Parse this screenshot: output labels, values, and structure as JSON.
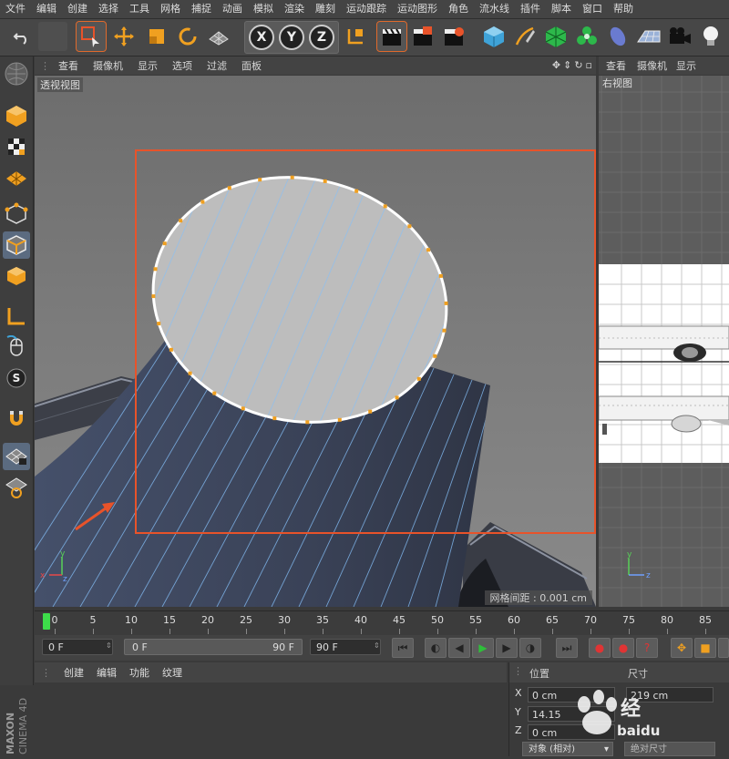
{
  "menu": [
    "文件",
    "编辑",
    "创建",
    "选择",
    "工具",
    "网格",
    "捕捉",
    "动画",
    "模拟",
    "渲染",
    "雕刻",
    "运动跟踪",
    "运动图形",
    "角色",
    "流水线",
    "插件",
    "脚本",
    "窗口",
    "帮助"
  ],
  "toolbar": {
    "axis_x": "X",
    "axis_y": "Y",
    "axis_z": "Z"
  },
  "viewport": {
    "menu": [
      "查看",
      "摄像机",
      "显示",
      "选项",
      "过滤",
      "面板"
    ],
    "name": "透视视图",
    "grid_spacing": "网格间距 : 0.001 cm"
  },
  "right_viewport": {
    "menu": [
      "查看",
      "摄像机",
      "显示"
    ],
    "name": "右视图"
  },
  "timeline": {
    "ticks": [
      "0",
      "5",
      "10",
      "15",
      "20",
      "25",
      "30",
      "35",
      "40",
      "45",
      "50",
      "55",
      "60",
      "65",
      "70",
      "75",
      "80",
      "85"
    ],
    "current_frame_marker": 0
  },
  "transport": {
    "start_frame": "0 F",
    "preview_start": "0 F",
    "preview_end": "90 F",
    "end_frame": "90 F"
  },
  "material_panel": {
    "menu": [
      "创建",
      "编辑",
      "功能",
      "纹理"
    ]
  },
  "coordinates_panel": {
    "position_label": "位置",
    "size_label": "尺寸",
    "x_label": "X",
    "x_value": "0 cm",
    "y_label": "Y",
    "y_value": "14.15",
    "z_label": "Z",
    "z_value": "0 cm",
    "size_x_value": "219 cm",
    "mode_select": "对象 (相对)",
    "size_mode": "绝对尺寸"
  },
  "branding": {
    "vertical_logo": "MAXON CINEMA 4D",
    "watermark": "Baidu经验"
  },
  "colors": {
    "selection_orange": "#e8532a",
    "point_orange": "#f0a020",
    "wire_blue": "#7eb3e8",
    "active_blue": "#5b6b80"
  }
}
